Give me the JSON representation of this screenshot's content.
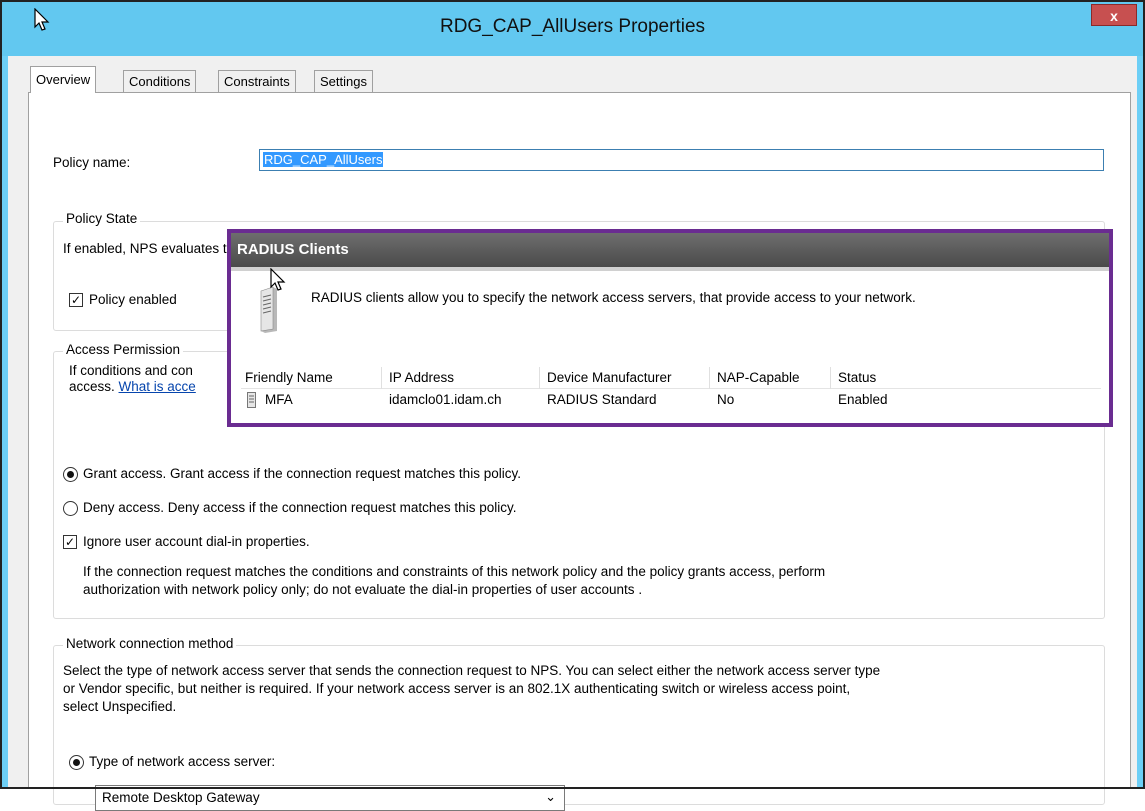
{
  "window": {
    "title": "RDG_CAP_AllUsers Properties",
    "close_label": "x"
  },
  "tabs": [
    {
      "label": "Overview",
      "active": true
    },
    {
      "label": "Conditions",
      "active": false
    },
    {
      "label": "Constraints",
      "active": false
    },
    {
      "label": "Settings",
      "active": false
    }
  ],
  "policy_name": {
    "label": "Policy name:",
    "value": "RDG_CAP_AllUsers"
  },
  "policy_state": {
    "title": "Policy State",
    "description": "If enabled, NPS evaluates this policy while performing authorization. If disabled, NPS does not evaluate this policy.",
    "enabled_label": "Policy enabled",
    "enabled": true
  },
  "access_permission": {
    "title": "Access Permission",
    "desc_line1": "If conditions and con",
    "desc_line2": "access. ",
    "link_text": "What is acce",
    "grant_label": "Grant access. Grant access if the connection request matches this policy.",
    "deny_label": "Deny access. Deny access if the connection request matches this policy.",
    "ignore_label": "Ignore user account dial-in properties.",
    "ignore_checked": true,
    "ignore_desc_line1": "If the connection request matches the conditions and constraints of this network policy and the policy grants access, perform",
    "ignore_desc_line2": "authorization with network policy only; do not evaluate the dial-in properties of user accounts ."
  },
  "network_connection": {
    "title": "Network connection method",
    "desc_line1": "Select the type of network access server that sends the connection request to NPS. You can select either the network access server type",
    "desc_line2": "or Vendor specific, but neither is required.  If your network access server is an 802.1X authenticating switch or wireless access point,",
    "desc_line3": "select Unspecified.",
    "type_label": "Type of network access server:",
    "type_value": "Remote Desktop Gateway"
  },
  "radius_clients": {
    "header": "RADIUS Clients",
    "description": "RADIUS clients allow you to specify the network access servers, that provide access to your network.",
    "columns": [
      "Friendly Name",
      "IP Address",
      "Device Manufacturer",
      "NAP-Capable",
      "Status"
    ],
    "rows": [
      {
        "name": "MFA",
        "ip": "idamclo01.idam.ch",
        "manufacturer": "RADIUS Standard",
        "nap": "No",
        "status": "Enabled"
      }
    ]
  },
  "colors": {
    "titlebar": "#62c8f0",
    "overlay_border": "#6a2c91",
    "selection": "#3399ff"
  }
}
